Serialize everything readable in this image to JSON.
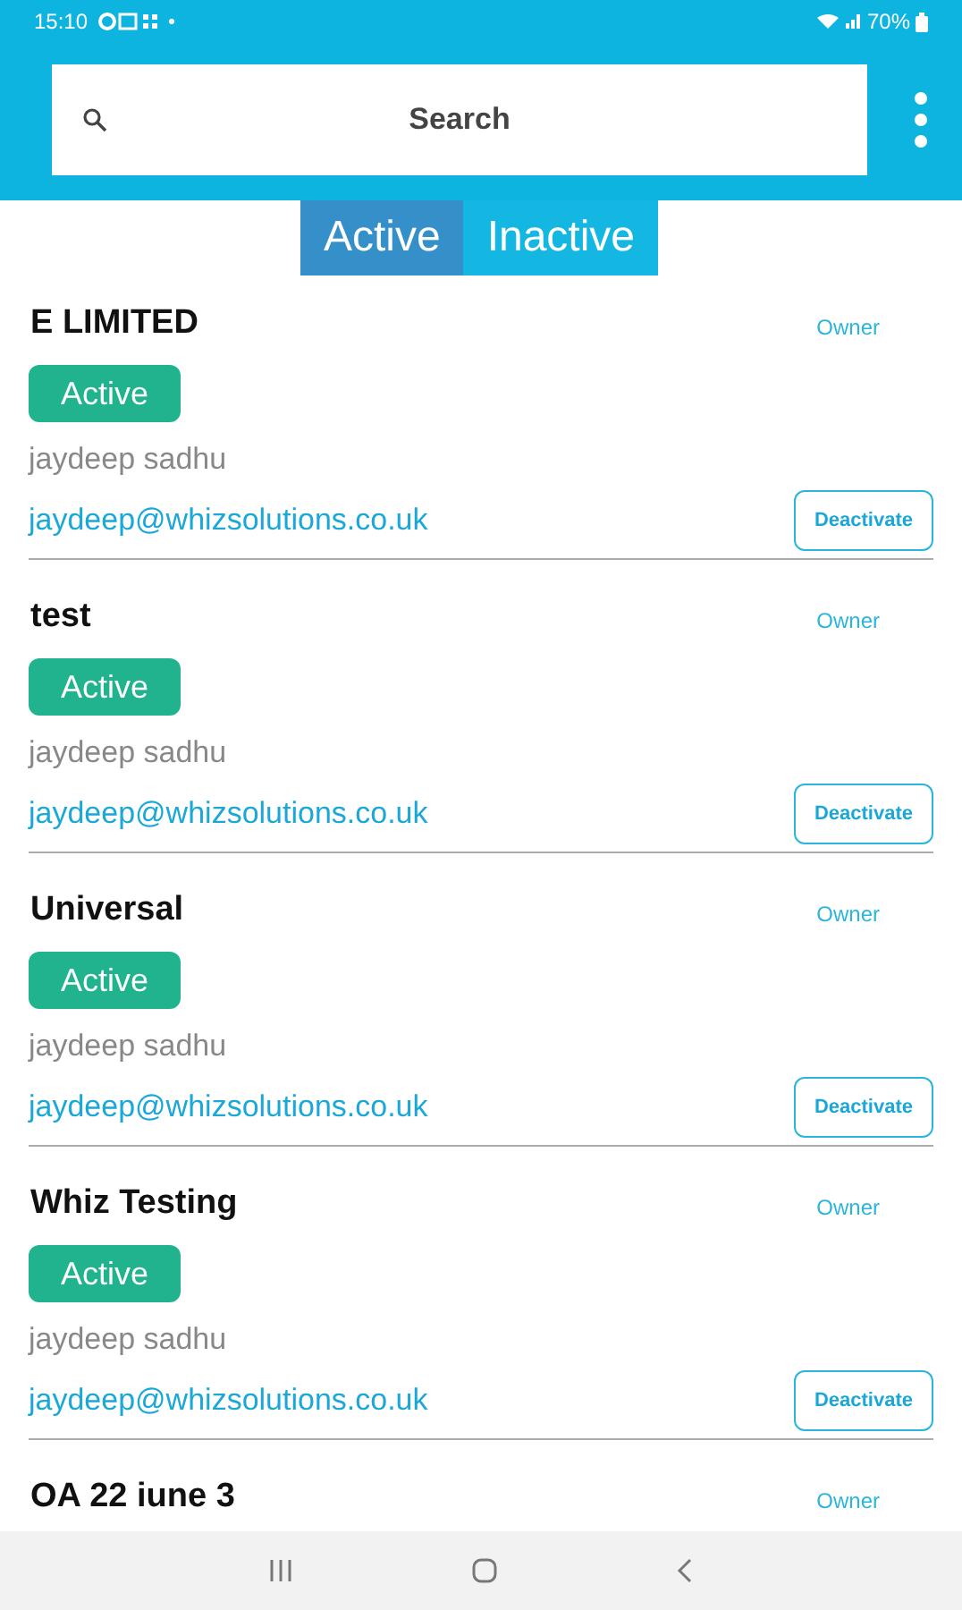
{
  "status_bar": {
    "time": "15:10",
    "battery": "70%"
  },
  "search": {
    "placeholder": "Search"
  },
  "tabs": [
    {
      "label": "Active",
      "selected": true
    },
    {
      "label": "Inactive",
      "selected": false
    }
  ],
  "companies": [
    {
      "name": "E LIMITED",
      "role": "Owner",
      "status": "Active",
      "contact": "jaydeep sadhu",
      "email": "jaydeep@whizsolutions.co.uk",
      "action": "Deactivate"
    },
    {
      "name": "test",
      "role": "Owner",
      "status": "Active",
      "contact": "jaydeep sadhu",
      "email": "jaydeep@whizsolutions.co.uk",
      "action": "Deactivate"
    },
    {
      "name": "Universal",
      "role": "Owner",
      "status": "Active",
      "contact": "jaydeep sadhu",
      "email": "jaydeep@whizsolutions.co.uk",
      "action": "Deactivate"
    },
    {
      "name": "Whiz Testing",
      "role": "Owner",
      "status": "Active",
      "contact": "jaydeep sadhu",
      "email": "jaydeep@whizsolutions.co.uk",
      "action": "Deactivate"
    },
    {
      "name": "OA 22 iune 3",
      "role": "Owner"
    }
  ]
}
